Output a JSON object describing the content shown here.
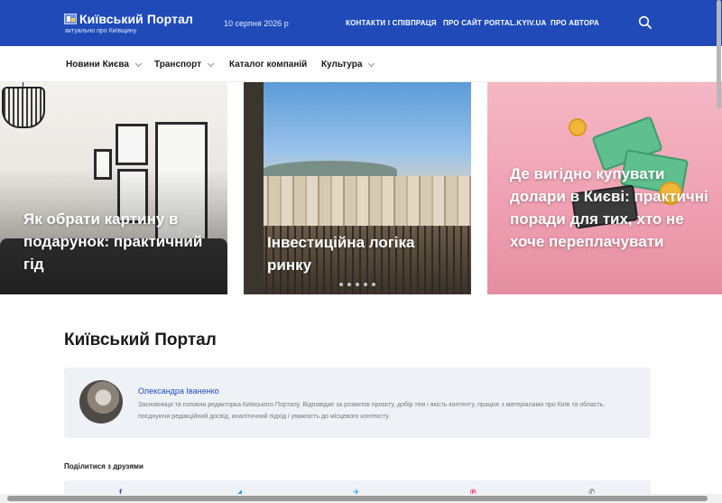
{
  "header": {
    "site_title": "Київський Портал",
    "tagline": "актуально про Київщину",
    "date": "10 серпня 2026 р",
    "links": [
      "КОНТАКТИ І СПІВПРАЦЯ",
      "ПРО САЙТ PORTAL.KYIV.UA",
      "ПРО АВТОРА"
    ],
    "search_icon": "search-icon"
  },
  "nav": {
    "items": [
      {
        "label": "Новини Києва",
        "dropdown": true
      },
      {
        "label": "Транспорт",
        "dropdown": true
      },
      {
        "label": "Каталог компаній",
        "dropdown": false
      },
      {
        "label": "Культура",
        "dropdown": true
      }
    ]
  },
  "hero": [
    {
      "title": "Як обрати картину в подарунок: практичний гід"
    },
    {
      "title": "Інвестиційна логіка ринку"
    },
    {
      "title": "Де вигідно купувати долари в Києві: практичні поради для тих, хто не хоче переплачувати"
    }
  ],
  "main": {
    "title": "Київський Портал",
    "author": {
      "name": "Олександра Іваненко",
      "bio": "Засновниця та головна редакторка Київського Порталу. Відповідає за розвиток проєкту, добір тем і якість контенту, працює з матеріалами про Київ та область, поєднуючи редакційний досвід, аналітичний підхід і уважність до місцевого контексту."
    },
    "share_label": "Поділитися з друзями",
    "share": [
      {
        "glyph": "f",
        "color": "#3b5998"
      },
      {
        "glyph": "◢",
        "color": "#2aa3d9"
      },
      {
        "glyph": "✈",
        "color": "#1da1f2"
      },
      {
        "glyph": "℗",
        "color": "#e60023"
      },
      {
        "glyph": "✆",
        "color": "#555555"
      }
    ]
  },
  "colors": {
    "brand": "#1f4ab8",
    "box_bg": "#eef2f7"
  }
}
